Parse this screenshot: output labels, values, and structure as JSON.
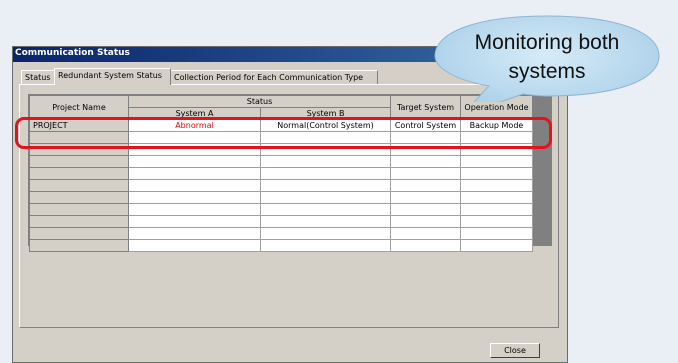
{
  "window": {
    "title": "Communication Status"
  },
  "tabs": [
    {
      "label": "Status",
      "active": false
    },
    {
      "label": "Redundant System Status",
      "active": true
    },
    {
      "label": "Collection Period for Each Communication Type",
      "active": false
    }
  ],
  "table": {
    "headers": {
      "project_name": "Project Name",
      "status_group": "Status",
      "system_a": "System A",
      "system_b": "System B",
      "target_system": "Target System",
      "operation_mode": "Operation Mode"
    },
    "rows": [
      {
        "project": "PROJECT",
        "system_a": "Abnormal",
        "system_b": "Normal(Control System)",
        "target_system": "Control System",
        "operation_mode": "Backup Mode"
      }
    ]
  },
  "buttons": {
    "close": "Close"
  },
  "callout": {
    "line1": "Monitoring both",
    "line2": "systems"
  },
  "colors": {
    "highlight": "#e0141e",
    "callout_fill": "#b8d8ee",
    "abnormal": "#d01010"
  }
}
